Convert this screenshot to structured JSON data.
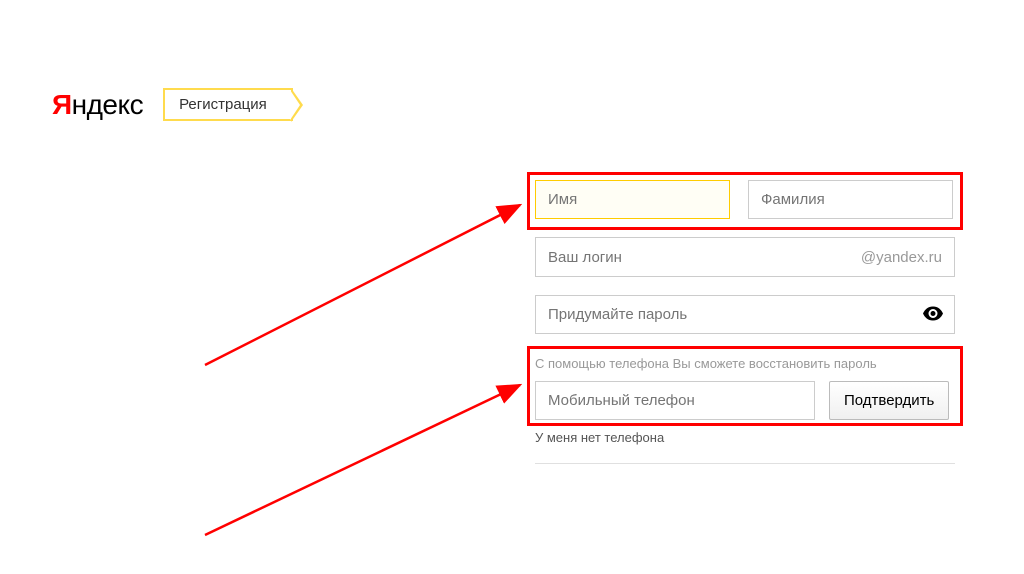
{
  "header": {
    "logo_text": "ндекс",
    "logo_letter": "Я",
    "registration_badge": "Регистрация"
  },
  "form": {
    "first_name_placeholder": "Имя",
    "last_name_placeholder": "Фамилия",
    "login_placeholder": "Ваш логин",
    "login_suffix": "@yandex.ru",
    "password_placeholder": "Придумайте пароль",
    "phone_hint": "С помощью телефона Вы сможете восстановить пароль",
    "phone_placeholder": "Мобильный телефон",
    "confirm_button": "Подтвердить",
    "no_phone_link": "У меня нет телефона"
  }
}
